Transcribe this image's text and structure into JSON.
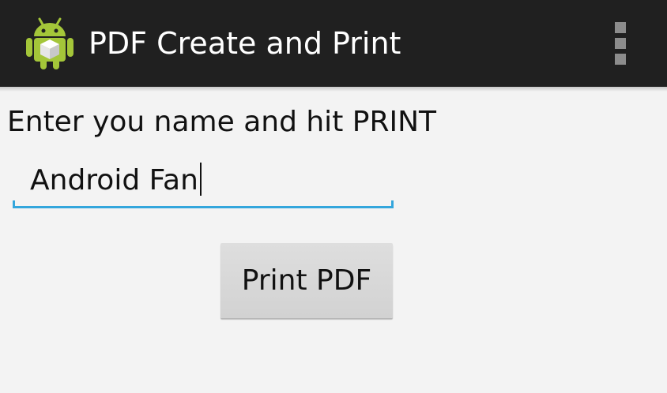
{
  "action_bar": {
    "title": "PDF Create and Print",
    "app_icon": "android-robot-icon",
    "menu_icon": "overflow-menu-icon"
  },
  "form": {
    "prompt": "Enter you name and hit PRINT",
    "name_value": "Android Fan",
    "print_label": "Print PDF"
  },
  "colors": {
    "action_bar_background": "#202020",
    "content_background": "#f3f3f3",
    "field_accent": "#33a6dc",
    "button_background": "#d8d8d8",
    "android_green": "#a4c639"
  }
}
